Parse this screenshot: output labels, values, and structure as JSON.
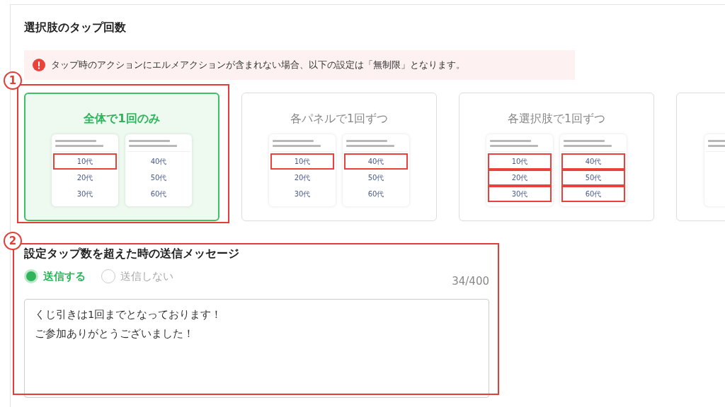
{
  "section_title": "選択肢のタップ回数",
  "alert": {
    "text": "タップ時のアクションにエルメアクションが含まれない場合、以下の設定は「無制限」となります。"
  },
  "cards": [
    {
      "title": "全体で1回のみ",
      "selected": true,
      "panels": [
        {
          "kind": "options",
          "options": [
            {
              "label": "10代",
              "highlighted": true
            },
            {
              "label": "20代",
              "highlighted": false
            },
            {
              "label": "30代",
              "highlighted": false
            }
          ]
        },
        {
          "kind": "options",
          "options": [
            {
              "label": "40代",
              "highlighted": false
            },
            {
              "label": "50代",
              "highlighted": false
            },
            {
              "label": "60代",
              "highlighted": false
            }
          ]
        }
      ]
    },
    {
      "title": "各パネルで1回ずつ",
      "selected": false,
      "panels": [
        {
          "kind": "options",
          "options": [
            {
              "label": "10代",
              "highlighted": true
            },
            {
              "label": "20代",
              "highlighted": false
            },
            {
              "label": "30代",
              "highlighted": false
            }
          ]
        },
        {
          "kind": "options",
          "options": [
            {
              "label": "40代",
              "highlighted": true
            },
            {
              "label": "50代",
              "highlighted": false
            },
            {
              "label": "60代",
              "highlighted": false
            }
          ]
        }
      ]
    },
    {
      "title": "各選択肢で1回ずつ",
      "selected": false,
      "panels": [
        {
          "kind": "options",
          "options": [
            {
              "label": "10代",
              "highlighted": true
            },
            {
              "label": "20代",
              "highlighted": true
            },
            {
              "label": "30代",
              "highlighted": true
            }
          ]
        },
        {
          "kind": "options",
          "options": [
            {
              "label": "40代",
              "highlighted": true
            },
            {
              "label": "50代",
              "highlighted": true
            },
            {
              "label": "60代",
              "highlighted": true
            }
          ]
        }
      ]
    },
    {
      "selected": false,
      "panels": [
        {
          "kind": "header-only"
        }
      ]
    }
  ],
  "message_section": {
    "title": "設定タップ数を超えた時の送信メッセージ",
    "radios": [
      {
        "label": "送信する",
        "selected": true
      },
      {
        "label": "送信しない",
        "selected": false
      }
    ],
    "counter": "34/400",
    "message_lines": [
      "くじ引きは1回までとなっております！",
      "ご参加ありがとうございました！"
    ]
  },
  "annotations": [
    {
      "number": "1"
    },
    {
      "number": "2"
    }
  ]
}
